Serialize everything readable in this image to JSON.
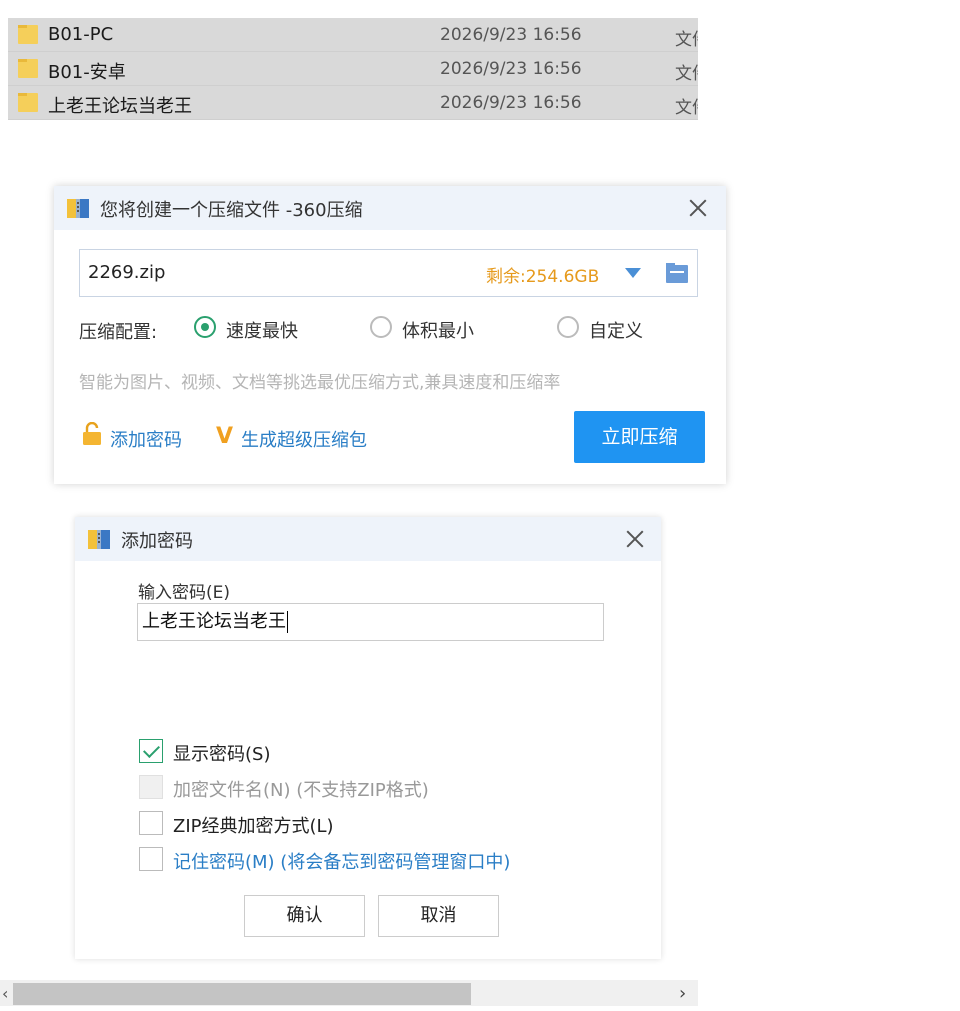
{
  "files": [
    {
      "name": "B01-PC",
      "date": "2026/9/23 16:56",
      "type": "文件夹"
    },
    {
      "name": "B01-安卓",
      "date": "2026/9/23 16:56",
      "type": "文件夹"
    },
    {
      "name": "上老王论坛当老王",
      "date": "2026/9/23 16:56",
      "type": "文件夹"
    }
  ],
  "compress_dialog": {
    "title": "您将创建一个压缩文件 -360压缩",
    "filename": "2269.zip",
    "free_space": "剩余:254.6GB",
    "config_label": "压缩配置:",
    "options": [
      "速度最快",
      "体积最小",
      "自定义"
    ],
    "selected_option": "速度最快",
    "hint": "智能为图片、视频、文档等挑选最优压缩方式,兼具速度和压缩率",
    "add_password_link": "添加密码",
    "super_pack_link": "生成超级压缩包",
    "compress_button": "立即压缩"
  },
  "password_dialog": {
    "title": "添加密码",
    "input_label": "输入密码(E)",
    "password_value": "上老王论坛当老王",
    "checkboxes": [
      {
        "label": "显示密码(S)",
        "checked": true,
        "enabled": true
      },
      {
        "label": "加密文件名(N) (不支持ZIP格式)",
        "checked": false,
        "enabled": false
      },
      {
        "label": "ZIP经典加密方式(L)",
        "checked": false,
        "enabled": true
      },
      {
        "label": "记住密码(M) (将会备忘到密码管理窗口中)",
        "checked": false,
        "enabled": true
      }
    ],
    "ok_button": "确认",
    "cancel_button": "取消"
  },
  "colors": {
    "primary_button": "#1f94f2",
    "link": "#2a7ec6",
    "free_space": "#e69a1c",
    "checked_green": "#2aa06e"
  }
}
